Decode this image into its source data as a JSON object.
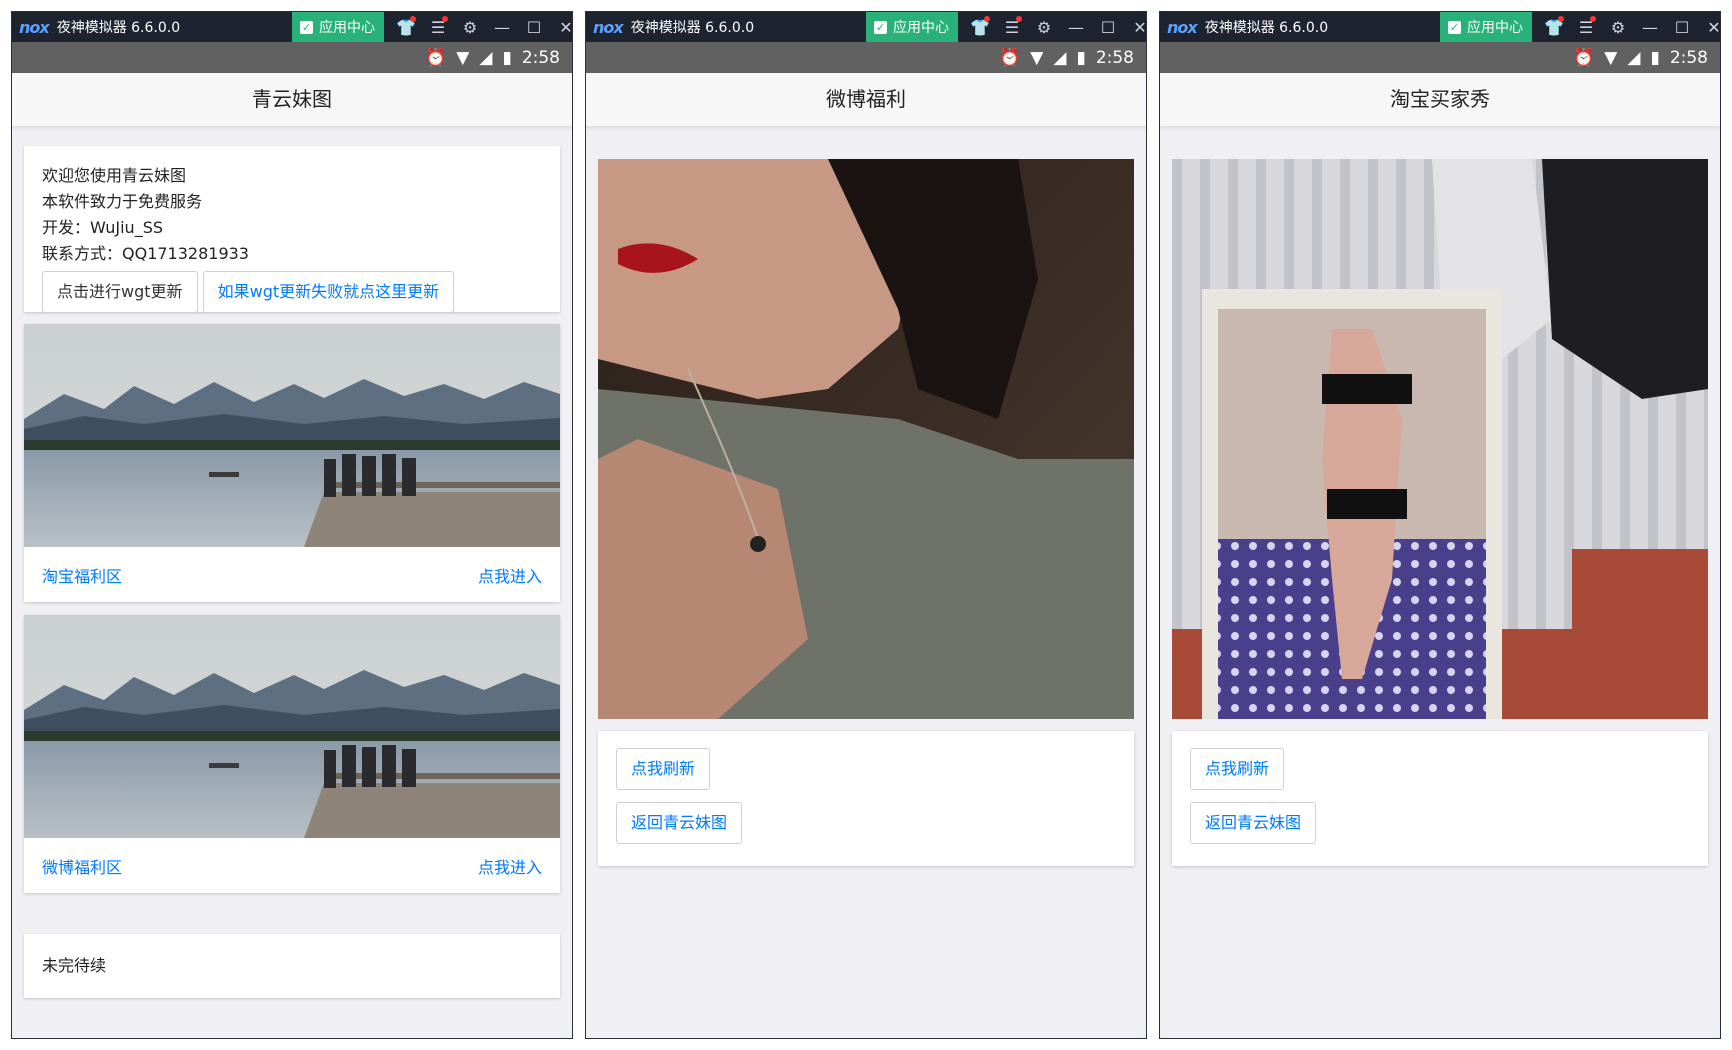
{
  "emulator": {
    "logo": "nox",
    "title": "夜神模拟器 6.6.0.0",
    "app_center": "应用中心",
    "status_time": "2:58"
  },
  "screen1": {
    "header": "青云妹图",
    "info_lines": [
      "欢迎您使用青云妹图",
      "本软件致力于免费服务",
      "开发：WuJiu_SS",
      "联系方式：QQ1713281933"
    ],
    "update_button": "点击进行wgt更新",
    "fallback_update_button": "如果wgt更新失败就点这里更新",
    "cards": [
      {
        "title": "淘宝福利区",
        "action": "点我进入"
      },
      {
        "title": "微博福利区",
        "action": "点我进入"
      }
    ],
    "pending_text": "未完待续"
  },
  "screen2": {
    "header": "微博福利",
    "refresh_button": "点我刷新",
    "back_button": "返回青云妹图"
  },
  "screen3": {
    "header": "淘宝买家秀",
    "refresh_button": "点我刷新",
    "back_button": "返回青云妹图"
  },
  "colors": {
    "titlebar": "#1e2330",
    "app_center": "#28b27a",
    "statusbar": "#616161",
    "link": "#007aff",
    "page_bg": "#f0f0f4"
  }
}
